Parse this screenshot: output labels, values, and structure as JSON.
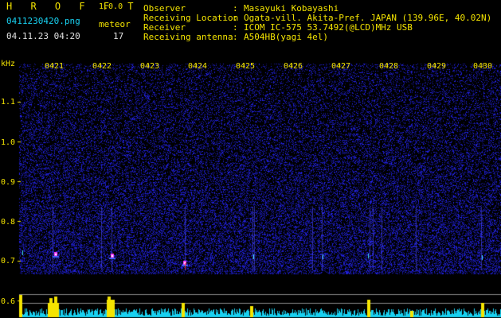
{
  "header": {
    "app_title": "H R O F F T",
    "version": "1.0.0",
    "filename": "0411230420.png",
    "meteor_label": "meteor",
    "timestamp": "04.11.23 04:20",
    "meteor_count": "17"
  },
  "info": [
    {
      "label": "Observer",
      "sep": ":",
      "value": "Masayuki Kobayashi"
    },
    {
      "label": "Receiving Location",
      "sep": ":",
      "value": "Ogata-vill. Akita-Pref. JAPAN (139.96E, 40.02N)"
    },
    {
      "label": "Receiver",
      "sep": ":",
      "value": "ICOM IC-575 53.7492(@LCD)MHz USB"
    },
    {
      "label": "Receiving antenna",
      "sep": ":",
      "value": "A504HB(yagi 4el)"
    }
  ],
  "spectrogram": {
    "y_unit": "kHz",
    "y_ticks": [
      "1.1",
      "1.0",
      "0.9",
      "0.8",
      "0.7",
      "0.6"
    ],
    "x_ticks": [
      "0421",
      "0422",
      "0423",
      "0424",
      "0425",
      "0426",
      "0427",
      "0428",
      "0429",
      "0430"
    ],
    "colors": {
      "background": "#000000",
      "noise": "#2020c0",
      "axis": "#f4e400",
      "spectrum": "#18d0f0",
      "peaks": "#f4e400"
    }
  }
}
